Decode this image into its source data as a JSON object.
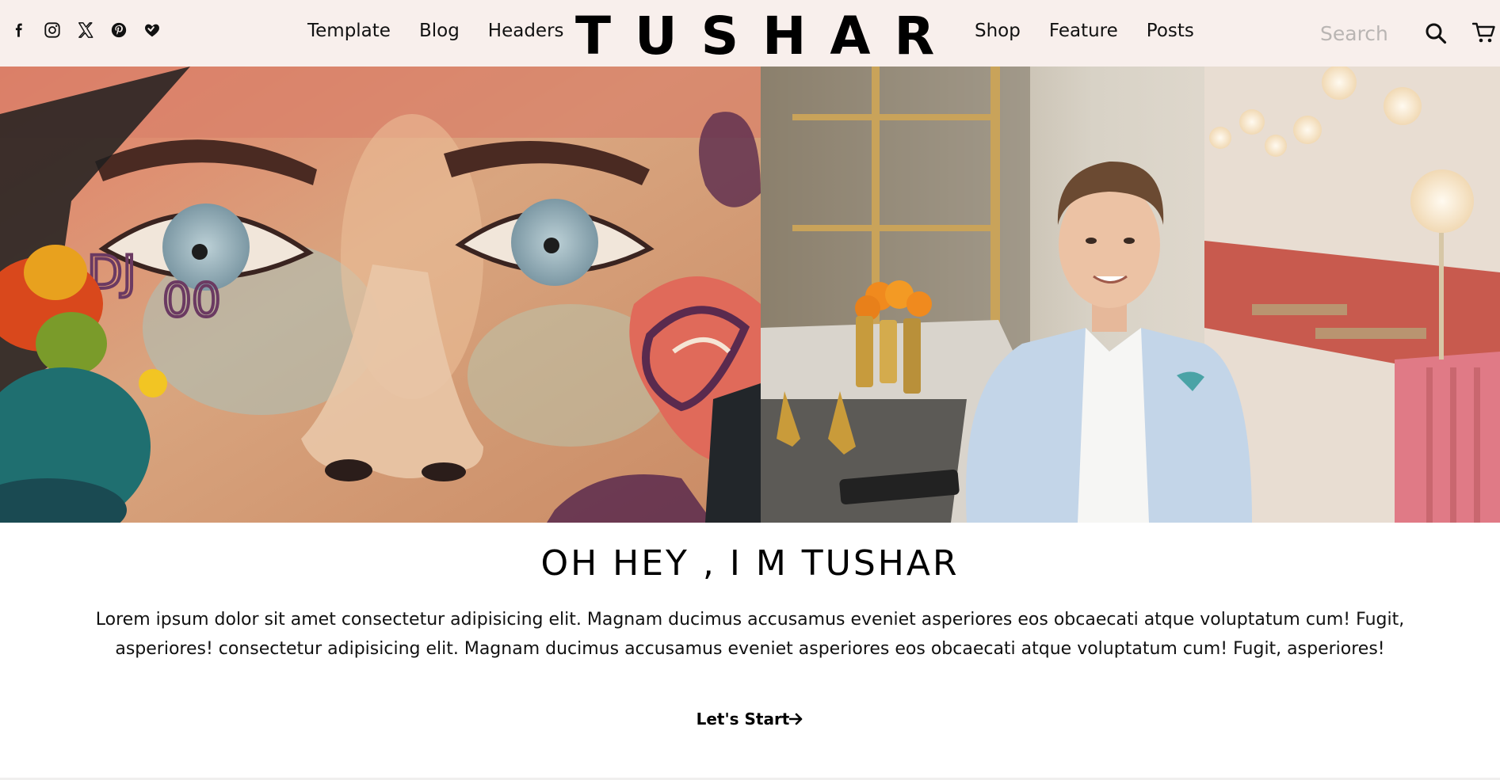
{
  "header": {
    "social_icons": [
      "facebook-icon",
      "instagram-icon",
      "x-twitter-icon",
      "pinterest-icon",
      "heart-hands-icon"
    ],
    "nav_left": [
      {
        "label": "Template"
      },
      {
        "label": "Blog"
      },
      {
        "label": "Headers"
      }
    ],
    "brand": "TUSHAR",
    "nav_right": [
      {
        "label": "Shop"
      },
      {
        "label": "Feature"
      },
      {
        "label": "Posts"
      }
    ],
    "search": {
      "placeholder": "Search",
      "value": ""
    },
    "icons": {
      "search": "search-icon",
      "cart": "cart-icon"
    },
    "background": "#f8efec"
  },
  "hero": {
    "images": [
      "graffiti-face-mural-image",
      "man-in-restaurant-portrait-image"
    ]
  },
  "intro": {
    "title": "OH HEY , I M TUSHAR",
    "paragraph": "Lorem ipsum dolor sit amet consectetur adipisicing elit. Magnam ducimus accusamus eveniet asperiores eos obcaecati atque voluptatum cum! Fugit, asperiores! consectetur adipisicing elit. Magnam ducimus accusamus eveniet asperiores eos obcaecati atque voluptatum cum! Fugit, asperiores!",
    "cta_label": "Let's Start",
    "cta_icon": "arrow-right-icon"
  }
}
